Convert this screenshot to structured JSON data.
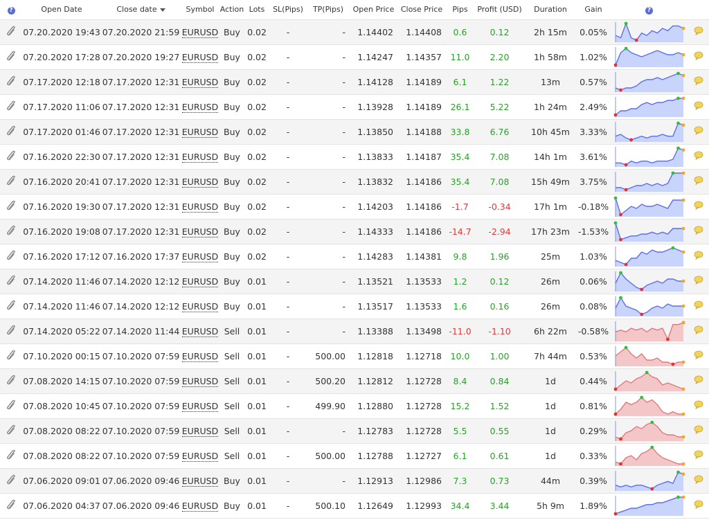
{
  "header": {
    "help_left": "?",
    "open_date": "Open Date",
    "close_date": "Close date",
    "symbol": "Symbol",
    "action": "Action",
    "lots": "Lots",
    "sl": "SL(Pips)",
    "tp": "TP(Pips)",
    "open_price": "Open Price",
    "close_price": "Close Price",
    "pips": "Pips",
    "profit": "Profit (USD)",
    "duration": "Duration",
    "gain": "Gain",
    "help_right": "?"
  },
  "colors": {
    "positive": "#2aa02a",
    "negative": "#e03a3a",
    "buy_fill": "#c8d4fb",
    "buy_line": "#5b6df0",
    "sell_fill": "#f3c6c8",
    "sell_line": "#e07a7e"
  },
  "rows": [
    {
      "open_date": "07.20.2020 19:43",
      "close_date": "07.20.2020 21:59",
      "symbol": "EURUSD",
      "action": "Buy",
      "lots": "0.02",
      "sl": "-",
      "tp": "-",
      "open_price": "1.14402",
      "close_price": "1.14408",
      "pips": "0.6",
      "profit": "0.12",
      "duration": "2h 15m",
      "gain": "0.05%",
      "sign": "pos",
      "spark": [
        4,
        3,
        9,
        3,
        2,
        5,
        4,
        6,
        5,
        7,
        6,
        8,
        8,
        7
      ]
    },
    {
      "open_date": "07.20.2020 17:28",
      "close_date": "07.20.2020 19:27",
      "symbol": "EURUSD",
      "action": "Buy",
      "lots": "0.02",
      "sl": "-",
      "tp": "-",
      "open_price": "1.14247",
      "close_price": "1.14357",
      "pips": "11.0",
      "profit": "2.20",
      "duration": "1h 58m",
      "gain": "1.02%",
      "sign": "pos",
      "spark": [
        0,
        6,
        8,
        6,
        5,
        4,
        5,
        6,
        7,
        6,
        5,
        5,
        6,
        5
      ]
    },
    {
      "open_date": "07.17.2020 12:18",
      "close_date": "07.17.2020 12:31",
      "symbol": "EURUSD",
      "action": "Buy",
      "lots": "0.02",
      "sl": "-",
      "tp": "-",
      "open_price": "1.14128",
      "close_price": "1.14189",
      "pips": "6.1",
      "profit": "1.22",
      "duration": "13m",
      "gain": "0.57%",
      "sign": "pos",
      "spark": [
        1,
        0,
        1,
        1,
        2,
        4,
        5,
        5,
        6,
        5,
        6,
        7,
        8,
        7
      ]
    },
    {
      "open_date": "07.17.2020 11:06",
      "close_date": "07.17.2020 12:31",
      "symbol": "EURUSD",
      "action": "Buy",
      "lots": "0.02",
      "sl": "-",
      "tp": "-",
      "open_price": "1.13928",
      "close_price": "1.14189",
      "pips": "26.1",
      "profit": "5.22",
      "duration": "1h 24m",
      "gain": "2.49%",
      "sign": "pos",
      "spark": [
        0,
        2,
        2,
        3,
        3,
        5,
        6,
        5,
        6,
        6,
        7,
        7,
        8,
        8
      ]
    },
    {
      "open_date": "07.17.2020 01:46",
      "close_date": "07.17.2020 12:31",
      "symbol": "EURUSD",
      "action": "Buy",
      "lots": "0.02",
      "sl": "-",
      "tp": "-",
      "open_price": "1.13850",
      "close_price": "1.14188",
      "pips": "33.8",
      "profit": "6.76",
      "duration": "10h 45m",
      "gain": "3.33%",
      "sign": "pos",
      "spark": [
        2,
        3,
        1,
        0,
        1,
        2,
        1,
        2,
        2,
        3,
        2,
        2,
        9,
        8
      ]
    },
    {
      "open_date": "07.16.2020 22:30",
      "close_date": "07.17.2020 12:31",
      "symbol": "EURUSD",
      "action": "Buy",
      "lots": "0.02",
      "sl": "-",
      "tp": "-",
      "open_price": "1.13833",
      "close_price": "1.14187",
      "pips": "35.4",
      "profit": "7.08",
      "duration": "14h 1m",
      "gain": "3.61%",
      "sign": "pos",
      "spark": [
        1,
        1,
        0,
        2,
        1,
        2,
        2,
        1,
        2,
        2,
        2,
        3,
        9,
        8
      ]
    },
    {
      "open_date": "07.16.2020 20:41",
      "close_date": "07.17.2020 12:31",
      "symbol": "EURUSD",
      "action": "Buy",
      "lots": "0.02",
      "sl": "-",
      "tp": "-",
      "open_price": "1.13832",
      "close_price": "1.14186",
      "pips": "35.4",
      "profit": "7.08",
      "duration": "15h 49m",
      "gain": "3.75%",
      "sign": "pos",
      "spark": [
        1,
        1,
        0,
        1,
        2,
        2,
        3,
        2,
        3,
        2,
        3,
        8,
        8,
        8
      ]
    },
    {
      "open_date": "07.16.2020 19:30",
      "close_date": "07.17.2020 12:31",
      "symbol": "EURUSD",
      "action": "Buy",
      "lots": "0.02",
      "sl": "-",
      "tp": "-",
      "open_price": "1.14203",
      "close_price": "1.14186",
      "pips": "-1.7",
      "profit": "-0.34",
      "duration": "17h 1m",
      "gain": "-0.18%",
      "sign": "neg",
      "spark": [
        8,
        0,
        2,
        4,
        3,
        5,
        4,
        4,
        5,
        4,
        3,
        7,
        7,
        7
      ]
    },
    {
      "open_date": "07.16.2020 19:08",
      "close_date": "07.17.2020 12:31",
      "symbol": "EURUSD",
      "action": "Buy",
      "lots": "0.02",
      "sl": "-",
      "tp": "-",
      "open_price": "1.14333",
      "close_price": "1.14186",
      "pips": "-14.7",
      "profit": "-2.94",
      "duration": "17h 23m",
      "gain": "-1.53%",
      "sign": "neg",
      "spark": [
        9,
        0,
        1,
        2,
        2,
        3,
        3,
        4,
        3,
        4,
        3,
        6,
        6,
        6
      ]
    },
    {
      "open_date": "07.16.2020 17:12",
      "close_date": "07.16.2020 17:37",
      "symbol": "EURUSD",
      "action": "Buy",
      "lots": "0.02",
      "sl": "-",
      "tp": "-",
      "open_price": "1.14283",
      "close_price": "1.14381",
      "pips": "9.8",
      "profit": "1.96",
      "duration": "25m",
      "gain": "1.03%",
      "sign": "pos",
      "spark": [
        2,
        1,
        0,
        3,
        3,
        6,
        5,
        7,
        6,
        6,
        7,
        8,
        7,
        6
      ]
    },
    {
      "open_date": "07.14.2020 11:46",
      "close_date": "07.14.2020 12:12",
      "symbol": "EURUSD",
      "action": "Buy",
      "lots": "0.01",
      "sl": "-",
      "tp": "-",
      "open_price": "1.13521",
      "close_price": "1.13533",
      "pips": "1.2",
      "profit": "0.12",
      "duration": "26m",
      "gain": "0.06%",
      "sign": "pos",
      "spark": [
        3,
        8,
        5,
        3,
        1,
        0,
        2,
        3,
        4,
        3,
        5,
        5,
        4,
        4
      ]
    },
    {
      "open_date": "07.14.2020 11:46",
      "close_date": "07.14.2020 12:12",
      "symbol": "EURUSD",
      "action": "Buy",
      "lots": "0.01",
      "sl": "-",
      "tp": "-",
      "open_price": "1.13517",
      "close_price": "1.13533",
      "pips": "1.6",
      "profit": "0.16",
      "duration": "26m",
      "gain": "0.08%",
      "sign": "pos",
      "spark": [
        3,
        8,
        4,
        3,
        2,
        0,
        1,
        3,
        4,
        3,
        5,
        4,
        4,
        4
      ]
    },
    {
      "open_date": "07.14.2020 05:22",
      "close_date": "07.14.2020 11:44",
      "symbol": "EURUSD",
      "action": "Sell",
      "lots": "0.01",
      "sl": "-",
      "tp": "-",
      "open_price": "1.13388",
      "close_price": "1.13498",
      "pips": "-11.0",
      "profit": "-1.10",
      "duration": "6h 22m",
      "gain": "-0.58%",
      "sign": "neg",
      "spark": [
        4,
        5,
        4,
        6,
        5,
        6,
        4,
        6,
        5,
        6,
        0,
        8,
        8,
        9
      ]
    },
    {
      "open_date": "07.10.2020 00:15",
      "close_date": "07.10.2020 07:59",
      "symbol": "EURUSD",
      "action": "Sell",
      "lots": "0.01",
      "sl": "-",
      "tp": "500.00",
      "open_price": "1.12818",
      "close_price": "1.12718",
      "pips": "10.0",
      "profit": "1.00",
      "duration": "7h 44m",
      "gain": "0.53%",
      "sign": "pos",
      "spark": [
        5,
        7,
        9,
        6,
        4,
        6,
        3,
        3,
        4,
        2,
        2,
        1,
        2,
        2
      ]
    },
    {
      "open_date": "07.08.2020 14:15",
      "close_date": "07.10.2020 07:59",
      "symbol": "EURUSD",
      "action": "Sell",
      "lots": "0.01",
      "sl": "-",
      "tp": "500.20",
      "open_price": "1.12812",
      "close_price": "1.12728",
      "pips": "8.4",
      "profit": "0.84",
      "duration": "1d",
      "gain": "0.44%",
      "sign": "pos",
      "spark": [
        1,
        3,
        5,
        4,
        6,
        7,
        9,
        7,
        6,
        3,
        4,
        3,
        2,
        1
      ]
    },
    {
      "open_date": "07.08.2020 10:45",
      "close_date": "07.10.2020 07:59",
      "symbol": "EURUSD",
      "action": "Sell",
      "lots": "0.01",
      "sl": "-",
      "tp": "499.90",
      "open_price": "1.12880",
      "close_price": "1.12728",
      "pips": "15.2",
      "profit": "1.52",
      "duration": "1d",
      "gain": "0.81%",
      "sign": "pos",
      "spark": [
        2,
        4,
        7,
        6,
        7,
        9,
        7,
        8,
        6,
        3,
        2,
        3,
        2,
        2
      ]
    },
    {
      "open_date": "07.08.2020 08:22",
      "close_date": "07.10.2020 07:59",
      "symbol": "EURUSD",
      "action": "Sell",
      "lots": "0.01",
      "sl": "-",
      "tp": "-",
      "open_price": "1.12783",
      "close_price": "1.12728",
      "pips": "5.5",
      "profit": "0.55",
      "duration": "1d",
      "gain": "0.29%",
      "sign": "pos",
      "spark": [
        2,
        1,
        4,
        5,
        7,
        6,
        8,
        9,
        7,
        4,
        3,
        3,
        2,
        2
      ]
    },
    {
      "open_date": "07.08.2020 08:22",
      "close_date": "07.10.2020 07:59",
      "symbol": "EURUSD",
      "action": "Sell",
      "lots": "0.01",
      "sl": "-",
      "tp": "500.00",
      "open_price": "1.12788",
      "close_price": "1.12727",
      "pips": "6.1",
      "profit": "0.61",
      "duration": "1d",
      "gain": "0.33%",
      "sign": "pos",
      "spark": [
        2,
        1,
        4,
        5,
        3,
        6,
        7,
        9,
        6,
        4,
        3,
        2,
        1,
        1
      ]
    },
    {
      "open_date": "07.06.2020 09:01",
      "close_date": "07.06.2020 09:46",
      "symbol": "EURUSD",
      "action": "Buy",
      "lots": "0.01",
      "sl": "-",
      "tp": "-",
      "open_price": "1.12913",
      "close_price": "1.12986",
      "pips": "7.3",
      "profit": "0.73",
      "duration": "44m",
      "gain": "0.39%",
      "sign": "pos",
      "spark": [
        2,
        1,
        2,
        1,
        2,
        2,
        1,
        0,
        2,
        3,
        4,
        3,
        9,
        8
      ]
    },
    {
      "open_date": "07.06.2020 04:37",
      "close_date": "07.06.2020 09:46",
      "symbol": "EURUSD",
      "action": "Buy",
      "lots": "0.01",
      "sl": "-",
      "tp": "500.10",
      "open_price": "1.12649",
      "close_price": "1.12993",
      "pips": "34.4",
      "profit": "3.44",
      "duration": "5h 9m",
      "gain": "1.89%",
      "sign": "pos",
      "spark": [
        0,
        1,
        2,
        3,
        3,
        4,
        5,
        5,
        6,
        6,
        7,
        8,
        9,
        9
      ]
    }
  ]
}
